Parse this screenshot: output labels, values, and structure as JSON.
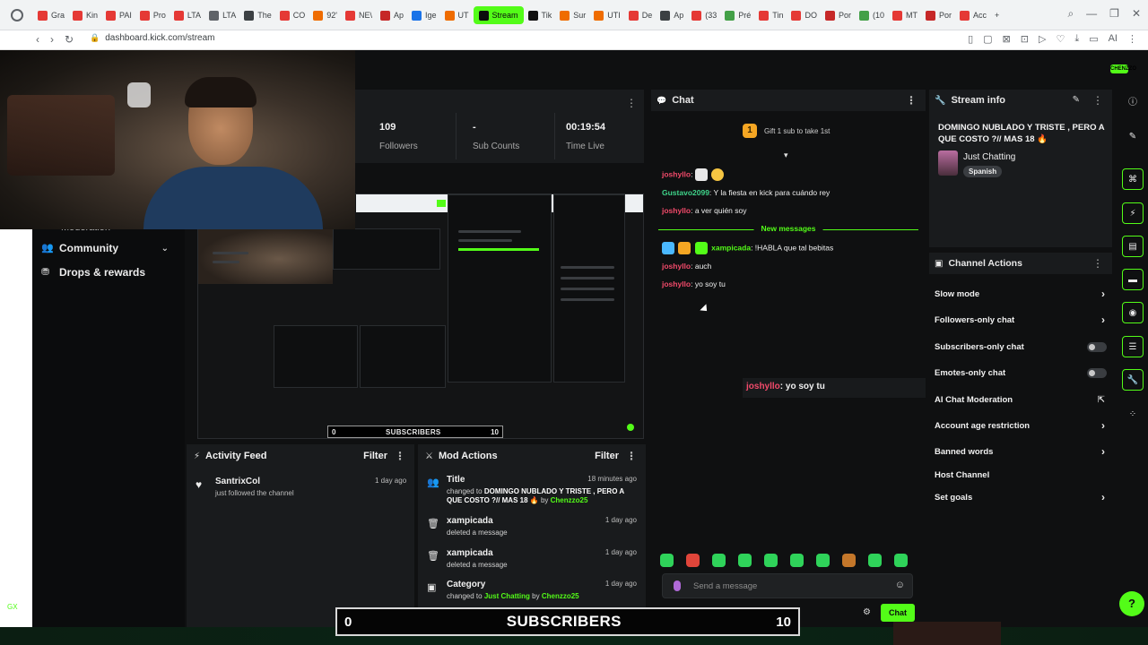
{
  "browser": {
    "tabs": [
      {
        "label": "Gra",
        "color": "#e53935"
      },
      {
        "label": "Kin",
        "color": "#e53935"
      },
      {
        "label": "PAI",
        "color": "#e53935"
      },
      {
        "label": "Pro",
        "color": "#e53935"
      },
      {
        "label": "LTA",
        "color": "#e53935"
      },
      {
        "label": "LTA",
        "color": "#5f6368"
      },
      {
        "label": "The",
        "color": "#3c4043"
      },
      {
        "label": "CO",
        "color": "#e53935"
      },
      {
        "label": "92'",
        "color": "#ef6c00"
      },
      {
        "label": "NE\\",
        "color": "#e53935"
      },
      {
        "label": "Ap",
        "color": "#c62828"
      },
      {
        "label": "Ige",
        "color": "#1a73e8"
      },
      {
        "label": "UT",
        "color": "#ef6c00"
      },
      {
        "label": "Stream",
        "color": "#0b0c0d",
        "active": true
      },
      {
        "label": "Tik",
        "color": "#111111"
      },
      {
        "label": "Sur",
        "color": "#ef6c00"
      },
      {
        "label": "UTI",
        "color": "#ef6c00"
      },
      {
        "label": "De",
        "color": "#e53935"
      },
      {
        "label": "Ap",
        "color": "#3c4043"
      },
      {
        "label": "(33",
        "color": "#e53935"
      },
      {
        "label": "Pré",
        "color": "#43a047"
      },
      {
        "label": "Tin",
        "color": "#e53935"
      },
      {
        "label": "DO",
        "color": "#e53935"
      },
      {
        "label": "Por",
        "color": "#c62828"
      },
      {
        "label": "(10",
        "color": "#43a047"
      },
      {
        "label": "MT",
        "color": "#e53935"
      },
      {
        "label": "Por",
        "color": "#c62828"
      },
      {
        "label": "Acc",
        "color": "#e53935"
      }
    ],
    "new_tab": "+",
    "url": "dashboard.kick.com/stream"
  },
  "profile_badge": "CHENZZO",
  "sidebar": {
    "cut_item": "Moderation",
    "items": [
      {
        "label": "Community",
        "icon": "community-icon",
        "expandable": true
      },
      {
        "label": "Drops & rewards",
        "icon": "drops-icon"
      }
    ]
  },
  "stats": {
    "followers": {
      "value": "109",
      "label": "Followers"
    },
    "subs": {
      "value": "-",
      "label": "Sub Counts"
    },
    "time": {
      "value": "00:19:54",
      "label": "Time Live"
    }
  },
  "preview": {
    "sub_left": "0",
    "sub_label": "SUBSCRIBERS",
    "sub_right": "10"
  },
  "activity": {
    "title": "Activity Feed",
    "filter": "Filter",
    "items": [
      {
        "name": "SantrixCol",
        "desc": "just followed the channel",
        "time": "1 day ago"
      }
    ]
  },
  "mod": {
    "title": "Mod Actions",
    "filter": "Filter",
    "items": [
      {
        "title": "Title",
        "prefix": "changed to ",
        "bold": "DOMINGO NUBLADO Y TRISTE , PERO A QUE COSTO ?// MAS 18 🔥",
        "by": " by ",
        "user": "Chenzzo25",
        "time": "18 minutes ago",
        "icon": "people-icon"
      },
      {
        "title": "xampicada",
        "desc": "deleted a message",
        "time": "1 day ago",
        "icon": "trash-icon"
      },
      {
        "title": "xampicada",
        "desc": "deleted a message",
        "time": "1 day ago",
        "icon": "trash-icon"
      },
      {
        "title": "Category",
        "prefix": "changed to ",
        "green": "Just Chatting",
        "by": " by ",
        "user": "Chenzzo25",
        "time": "1 day ago",
        "icon": "category-icon"
      }
    ]
  },
  "chat": {
    "title": "Chat",
    "gift_rank": "1",
    "gift_text": "Gift 1 sub to take 1st",
    "messages": [
      {
        "user": "joshyllo",
        "text": ":",
        "color": "pink"
      },
      {
        "user": "Gustavo2099",
        "text": ": Y la fiesta en kick para cuándo rey",
        "color": "teal"
      },
      {
        "user": "joshyllo",
        "text": ": a ver quién soy",
        "color": "pink"
      },
      {
        "user": "xampicada",
        "text": ": !HABLA que tal bebitas",
        "color": "green"
      },
      {
        "user": "joshyllo",
        "text": ": auch",
        "color": "pink"
      },
      {
        "user": "joshyllo",
        "text": ": yo soy tu",
        "color": "pink"
      }
    ],
    "new_messages": "New messages",
    "placeholder": "Send a message",
    "count": "0",
    "send": "Chat"
  },
  "overlay_msg": {
    "user": "joshyllo",
    "text": ": yo soy tu"
  },
  "stream_info": {
    "header": "Stream info",
    "title": "DOMINGO NUBLADO Y TRISTE , PERO A QUE COSTO ?// MAS 18 🔥",
    "category": "Just Chatting",
    "language": "Spanish"
  },
  "channel_actions": {
    "header": "Channel Actions",
    "items": [
      {
        "label": "Slow mode",
        "control": "chevron"
      },
      {
        "label": "Followers-only chat",
        "control": "chevron"
      },
      {
        "label": "Subscribers-only chat",
        "control": "toggle",
        "checked": false
      },
      {
        "label": "Emotes-only chat",
        "control": "toggle",
        "checked": false
      },
      {
        "label": "AI Chat Moderation",
        "control": "external"
      },
      {
        "label": "Account age restriction",
        "control": "chevron"
      },
      {
        "label": "Banned words",
        "control": "chevron"
      },
      {
        "label": "Host Channel",
        "control": "none"
      },
      {
        "label": "Set goals",
        "control": "chevron"
      }
    ]
  },
  "subscribers_overlay": {
    "left": "0",
    "label": "SUBSCRIBERS",
    "right": "10"
  },
  "left_edge_badge": "GX",
  "colors": {
    "accent": "#53fc18",
    "panel": "#191b1d",
    "bg": "#0f1011",
    "username_pink": "#f24a6a"
  }
}
